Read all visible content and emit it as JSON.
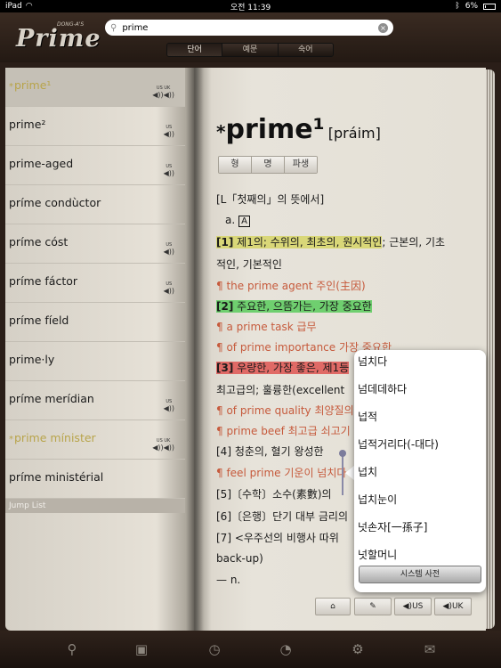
{
  "status": {
    "carrier": "iPad",
    "time": "오전 11:39",
    "battery": "6%"
  },
  "header": {
    "logo_text": "Prime",
    "logo_maker": "DONG-A'S",
    "search_value": "prime",
    "segments": [
      "단어",
      "예문",
      "숙어"
    ]
  },
  "wordlist": {
    "items": [
      {
        "label": "prime¹",
        "audio": "US UK"
      },
      {
        "label": "prime²",
        "audio": "US"
      },
      {
        "label": "prime-aged",
        "audio": "US"
      },
      {
        "label": "príme condùctor",
        "audio": ""
      },
      {
        "label": "príme cóst",
        "audio": "US"
      },
      {
        "label": "príme fáctor",
        "audio": "US"
      },
      {
        "label": "príme fíeld",
        "audio": ""
      },
      {
        "label": "prime·ly",
        "audio": ""
      },
      {
        "label": "príme merídian",
        "audio": "US"
      },
      {
        "label": "prime mínister",
        "audio": "US UK"
      },
      {
        "label": "príme ministérial",
        "audio": ""
      }
    ],
    "jump_list": "Jump List"
  },
  "entry": {
    "headword": "prime¹",
    "pronunciation": "[práim]",
    "tabs": [
      "형",
      "명",
      "파생"
    ],
    "etymology": "[L「첫째의」의 뜻에서]",
    "pos": "a.",
    "pos_box": "A",
    "sense1_no": "[1]",
    "sense1_hl": "제1의; 수위의, 최초의, 원시적인",
    "sense1_rest": "; 근본의, 기초",
    "sense1_cont": "적인, 기본적인",
    "ex1": "¶ the prime agent 주인(主因)",
    "sense2_no": "[2]",
    "sense2_hl": "주요한, 으뜸가는, 가장 중요한",
    "ex2": "¶ a prime task 급무",
    "ex3": "¶ of prime importance 가장 중요한",
    "sense3_no": "[3]",
    "sense3_hl": "우량한, 가장 좋은, 제1등",
    "sense3_cont": "최고급의; 훌륭한(excellent",
    "ex4": "¶ of prime quality 최양질의",
    "ex5": "¶ prime beef 최고급 쇠고기",
    "sense4": "[4] 청춘의, 혈기 왕성한",
    "ex6": "¶ feel prime 기운이 넘치다",
    "sense5": "[5]〔수학〕소수(素數)의",
    "sense6": "[6]〔은행〕단기 대부 금리의",
    "sense7": "[7] <우주선의 비행사 따위",
    "sense7_cont": "back-up)",
    "dash_n": "— n.",
    "bottom_buttons": [
      "✎",
      "US",
      "UK"
    ]
  },
  "popup": {
    "items": [
      "넘치다",
      "넘데데하다",
      "넙적",
      "넙적거리다(-대다)",
      "넙치",
      "넙치눈이",
      "넛손자[一孫子]",
      "넛할머니"
    ],
    "system_dict": "시스템 사전"
  },
  "tabbar": {
    "icons": [
      "search-icon",
      "dictionary-icon",
      "history-icon",
      "timer-icon",
      "settings-icon",
      "mail-icon"
    ]
  }
}
